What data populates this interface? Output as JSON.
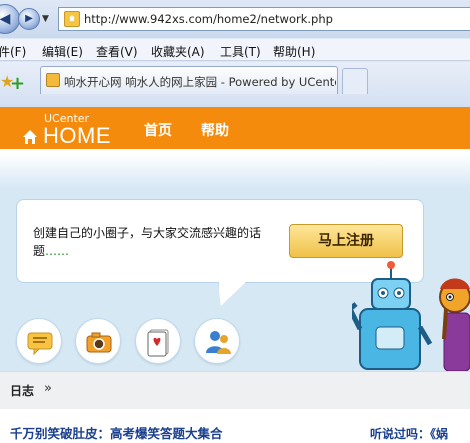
{
  "browser": {
    "address_url": "http://www.942xs.com/home2/network.php",
    "menu": [
      "件(F)",
      "编辑(E)",
      "查看(V)",
      "收藏夹(A)",
      "工具(T)",
      "帮助(H)"
    ],
    "tab_title": "响水开心网 响水人的网上家园 - Powered by UCenter Home"
  },
  "site": {
    "logo_top": "UCenter",
    "logo_main": "HOME",
    "nav": [
      "首页",
      "帮助"
    ],
    "accent_color": "#f48b0d"
  },
  "banner": {
    "bubble_text": "创建自己的小圈子，与大家交流感兴趣的话题",
    "bubble_ellipsis": "……",
    "register_label": "马上注册",
    "icons": [
      "comment-icon",
      "camera-icon",
      "cards-icon",
      "people-icon"
    ]
  },
  "breadcrumb": {
    "label": "日志",
    "sep": "»"
  },
  "content": {
    "article_1": "千万别笑破肚皮：高考爆笑答题大集合",
    "article_2": "听说过吗：《娲"
  }
}
